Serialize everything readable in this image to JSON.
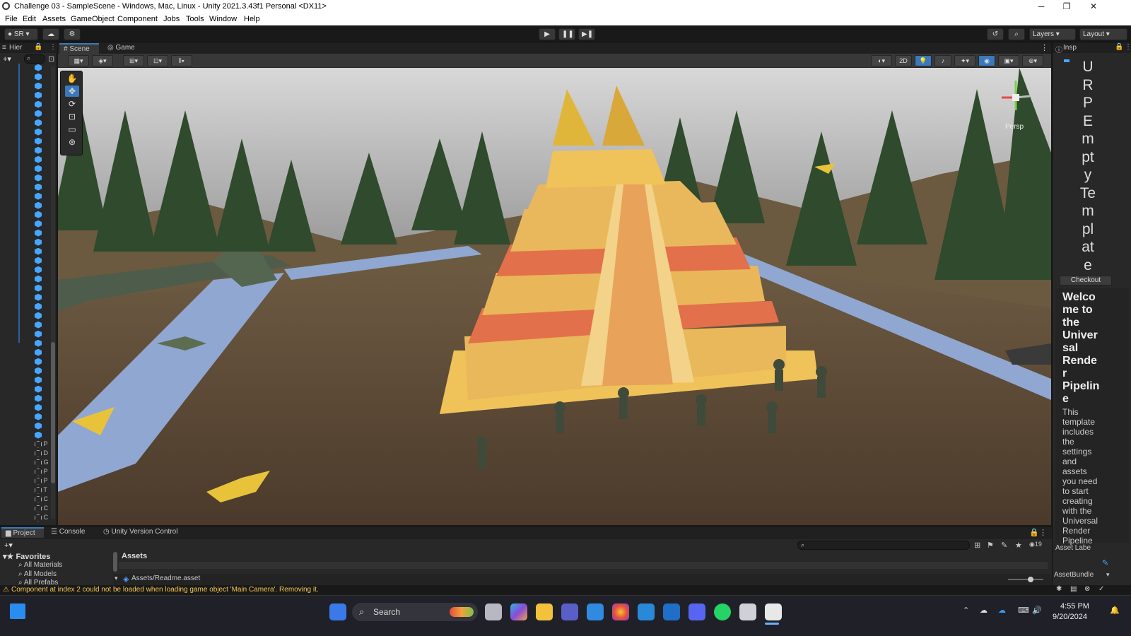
{
  "window": {
    "title": "Challenge 03 - SampleScene - Windows, Mac, Linux - Unity 2021.3.43f1 Personal <DX11>",
    "controls": [
      "─",
      "❐",
      "✕"
    ]
  },
  "menu": [
    "File",
    "Edit",
    "Assets",
    "GameObject",
    "Component",
    "Jobs",
    "Tools",
    "Window",
    "Help"
  ],
  "toolbar": {
    "account": "SR",
    "layers": "Layers",
    "layout": "Layout"
  },
  "hierarchy": {
    "tab": "Hier",
    "search_placeholder": "",
    "collapsed_items": [
      "P",
      "D",
      "G",
      "P",
      "P",
      "T",
      "C",
      "C",
      "C"
    ]
  },
  "scene": {
    "tabs": [
      "Scene",
      "Game"
    ],
    "mode_2d": "2D",
    "persp_label": "Persp"
  },
  "inspector": {
    "tab": "Insp",
    "vertical_title": [
      "U",
      "R",
      "P",
      "E",
      "m",
      "pt",
      "y",
      "Te",
      "m",
      "pl",
      "at",
      "e"
    ],
    "checkout": "Checkout",
    "welcome_heading": [
      "Welco",
      "me to",
      "the",
      "Univer",
      "sal",
      "Rende",
      "r",
      "Pipelin",
      "e"
    ],
    "welcome_body": [
      "This",
      "template",
      "includes",
      "the",
      "settings",
      "and",
      "assets",
      "you need",
      "to start",
      "creating",
      "with the",
      "Universal",
      "Render",
      "Pipeline"
    ],
    "asset_labels": "Asset Labe",
    "asset_bundle": "AssetBundle"
  },
  "bottom": {
    "tabs": [
      "Project",
      "Console",
      "Unity Version Control"
    ],
    "favorites_label": "Favorites",
    "favorites": [
      "All Materials",
      "All Models",
      "All Prefabs"
    ],
    "assets_label": "Assets",
    "asset_path": "Assets/Readme.asset",
    "hidden_count": "19"
  },
  "status": {
    "message": "Component at index 2 could not be loaded when loading game object 'Main Camera'. Removing it."
  },
  "taskbar": {
    "search": "Search",
    "time": "4:55 PM",
    "date": "9/20/2024"
  }
}
